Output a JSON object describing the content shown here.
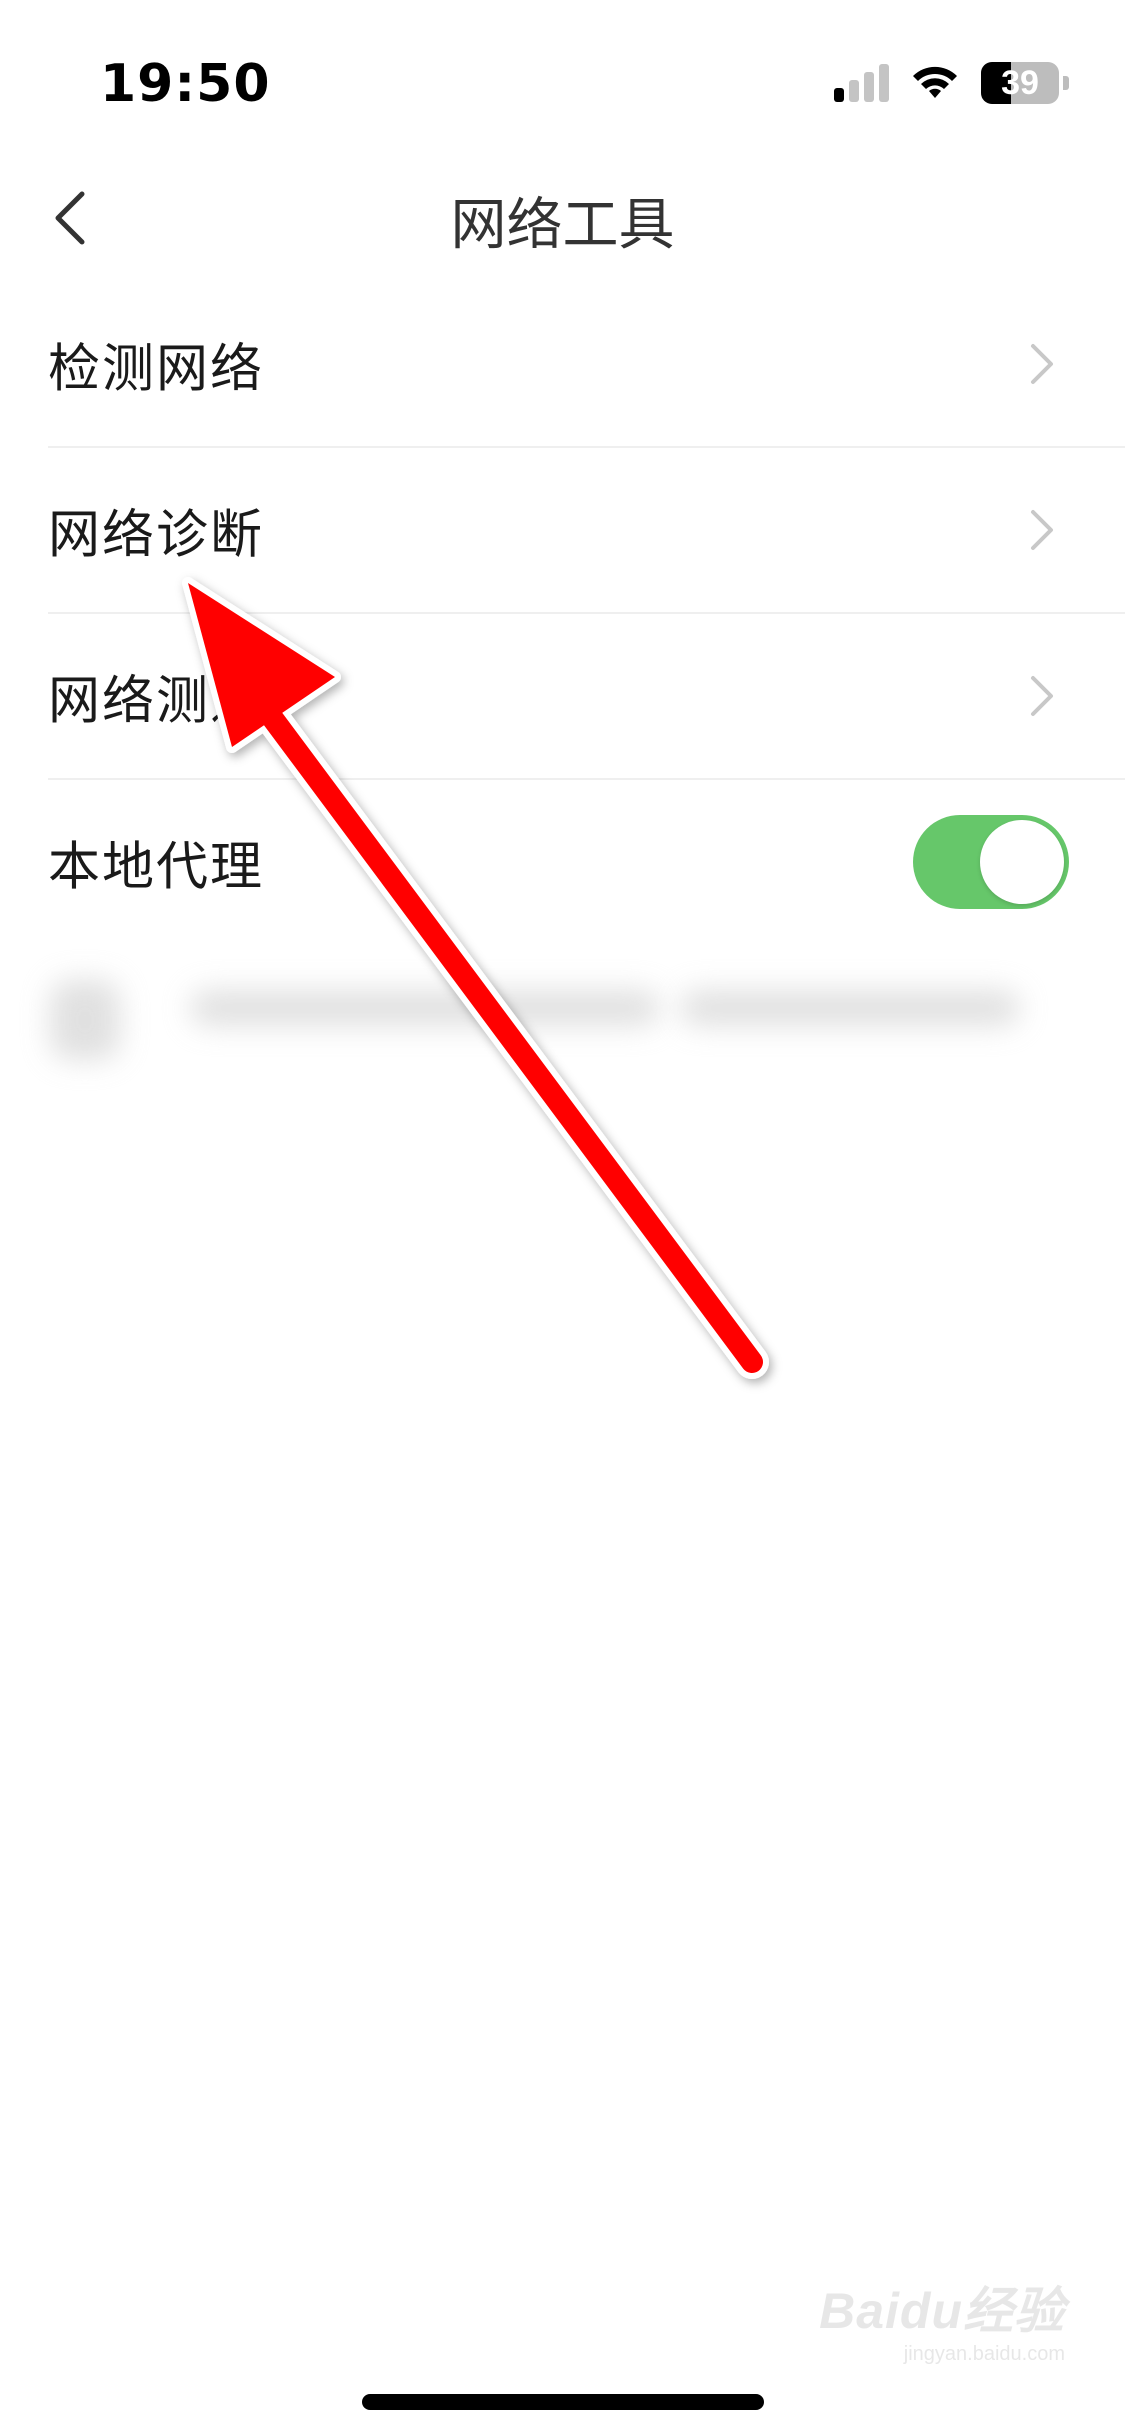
{
  "status_bar": {
    "time": "19:50",
    "battery_percent": "39",
    "signal_level": 1,
    "icons": [
      "signal-icon",
      "wifi-icon",
      "battery-icon"
    ]
  },
  "nav": {
    "title": "网络工具",
    "back_icon": "chevron-left-icon"
  },
  "list": {
    "items": [
      {
        "label": "检测网络",
        "accessory": "chevron-right-icon"
      },
      {
        "label": "网络诊断",
        "accessory": "chevron-right-icon"
      },
      {
        "label": "网络测速",
        "accessory": "chevron-right-icon"
      },
      {
        "label": "本地代理",
        "accessory": "toggle",
        "toggle_on": true
      }
    ]
  },
  "colors": {
    "toggle_on": "#66c76a",
    "annotation_arrow": "#ff0000",
    "background": "#ffffff"
  },
  "watermark": {
    "logo": "Baidu经验",
    "sub": "jingyan.baidu.com"
  }
}
